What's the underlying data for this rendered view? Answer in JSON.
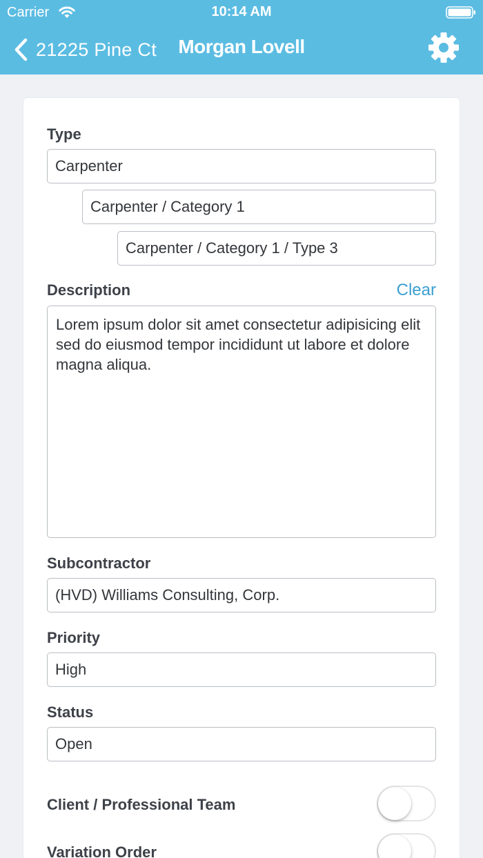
{
  "status_bar": {
    "carrier": "Carrier",
    "time": "10:14 AM"
  },
  "nav": {
    "back_label": "21225 Pine Ct",
    "title": "Morgan Lovell",
    "settings_icon": "gear-icon"
  },
  "form": {
    "type_label": "Type",
    "type_level1": "Carpenter",
    "type_level2": "Carpenter / Category 1",
    "type_level3": "Carpenter / Category 1 / Type 3",
    "description_label": "Description",
    "clear_label": "Clear",
    "description_value": "Lorem ipsum dolor sit amet  consectetur adipisicing elit sed do eiusmod tempor incididunt ut labore et dolore magna aliqua.",
    "subcontractor_label": "Subcontractor",
    "subcontractor_value": "(HVD) Williams Consulting, Corp.",
    "priority_label": "Priority",
    "priority_value": "High",
    "status_label": "Status",
    "status_value": "Open",
    "client_team_label": "Client / Professional Team",
    "client_team_on": false,
    "variation_order_label": "Variation Order",
    "variation_order_on": false
  },
  "colors": {
    "header": "#5bbce2",
    "accent": "#3a9fd0",
    "background": "#eff1f5"
  }
}
